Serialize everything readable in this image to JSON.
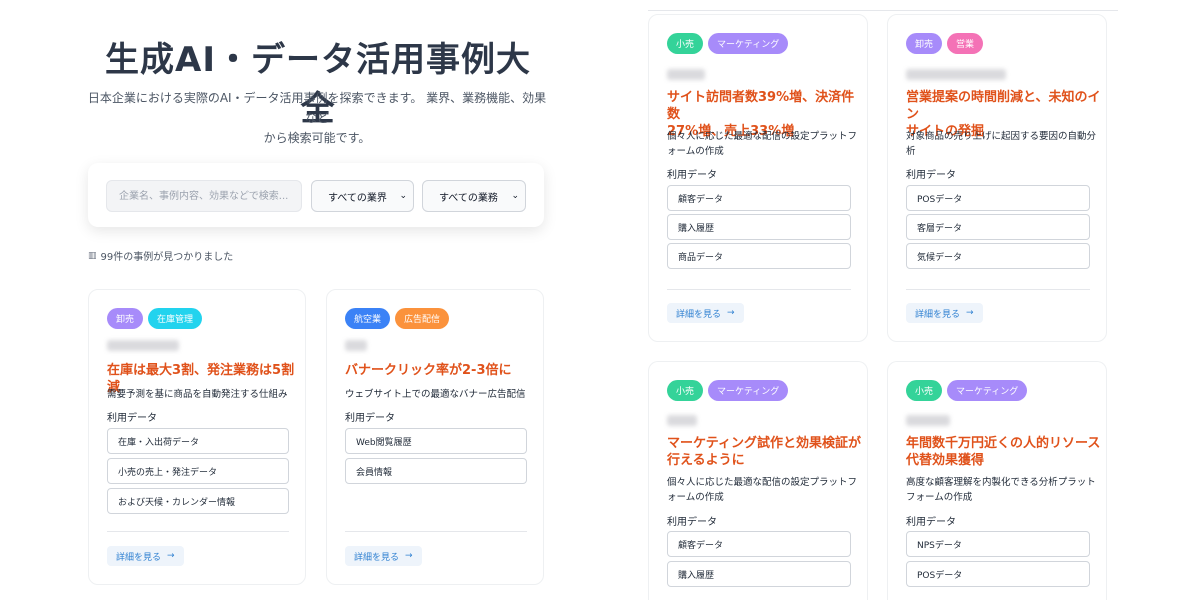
{
  "header": {
    "title": "生成AI・データ活用事例大全",
    "subtitle_line1": "日本企業における実際のAI・データ活用事例を探索できます。 業界、業務機能、効果など",
    "subtitle_line2": "から検索可能です。"
  },
  "search": {
    "placeholder": "企業名、事例内容、効果などで検索...",
    "industry_selected": "すべての業界",
    "function_selected": "すべての業務"
  },
  "results": {
    "count_text": "99件の事例が見つかりました",
    "icon": "bar-chart-icon"
  },
  "labels": {
    "data_label": "利用データ",
    "detail_button": "詳細を見る",
    "arrow": "→"
  },
  "colors": {
    "tag_wholesale": "#a78bfa",
    "tag_inventory": "#22d3ee",
    "tag_airline": "#3b82f6",
    "tag_ads": "#fb923c",
    "tag_retail": "#34d399",
    "tag_marketing": "#a78bfa",
    "tag_sales": "#f472b6",
    "headline": "#e0521b",
    "detail_text": "#2f80d1"
  },
  "cards": [
    {
      "tags": [
        "卸売",
        "在庫管理"
      ],
      "headline": "在庫は最大3割、発注業務は5割減",
      "description": "需要予測を基に商品を自動発注する仕組み",
      "data": [
        "在庫・入出荷データ",
        "小売の売上・発注データ",
        "および天候・カレンダー情報"
      ]
    },
    {
      "tags": [
        "航空業",
        "広告配信"
      ],
      "headline": "バナークリック率が2-3倍に",
      "description": "ウェブサイト上での最適なバナー広告配信",
      "data": [
        "Web閲覧履歴",
        "会員情報"
      ]
    },
    {
      "tags": [
        "小売",
        "マーケティング"
      ],
      "headline_line1": "サイト訪問者数39%増、決済件数",
      "headline_line2": "27%増、売上33%増",
      "description_line1": "個々人に応じた最適な配信の設定プラットフ",
      "description_line2": "ォームの作成",
      "data": [
        "顧客データ",
        "購入履歴",
        "商品データ"
      ]
    },
    {
      "tags": [
        "卸売",
        "営業"
      ],
      "headline_line1": "営業提案の時間削減と、未知のイン",
      "headline_line2": "サイトの発掘",
      "description_line1": "対象商品の売り上げに起因する要因の自動分",
      "description_line2": "析",
      "data": [
        "POSデータ",
        "客層データ",
        "気候データ"
      ]
    },
    {
      "tags": [
        "小売",
        "マーケティング"
      ],
      "headline_line1": "マーケティング試作と効果検証が",
      "headline_line2": "行えるように",
      "description_line1": "個々人に応じた最適な配信の設定プラットフ",
      "description_line2": "ォームの作成",
      "data": [
        "顧客データ",
        "購入履歴"
      ]
    },
    {
      "tags": [
        "小売",
        "マーケティング"
      ],
      "headline_line1": "年間数千万円近くの人的リソース",
      "headline_line2": "代替効果獲得",
      "description_line1": "高度な顧客理解を内製化できる分析プラット",
      "description_line2": "フォームの作成",
      "data": [
        "NPSデータ",
        "POSデータ"
      ]
    }
  ]
}
